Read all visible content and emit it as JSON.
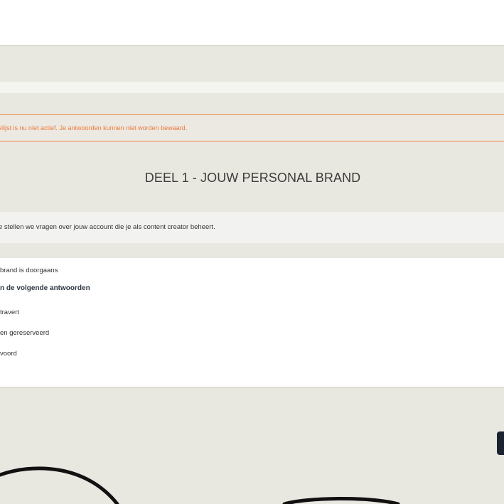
{
  "warning": {
    "text": "elijst is nu niet actief. Je antwoorden kunnen niet worden bewaard."
  },
  "section": {
    "title": "DEEL 1 - JOUW PERSONAL BRAND",
    "intro": "e stellen we vragen over jouw account die je als content creator beheert."
  },
  "question": {
    "text": "brand is doorgaans",
    "hint": "n de volgende antwoorden",
    "options": [
      "travert",
      "en gereserveerd",
      "voord"
    ]
  },
  "colors": {
    "background": "#e9e8e0",
    "warning_accent": "#f07a3e",
    "dark_button": "#1b2230"
  }
}
